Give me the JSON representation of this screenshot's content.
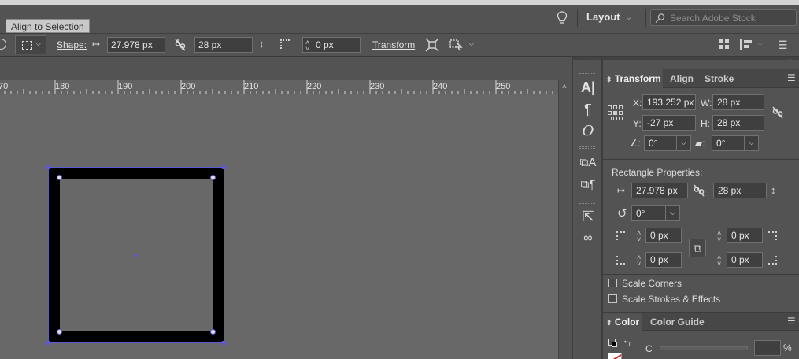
{
  "tooltip": "Align to Selection",
  "workspace": {
    "label": "Layout"
  },
  "stock_search": {
    "placeholder": "Search Adobe Stock"
  },
  "control_bar": {
    "shape_label": "Shape:",
    "width_value": "27.978 px",
    "height_value": "28 px",
    "corner_value": "0 px",
    "transform_label": "Transform"
  },
  "ruler": {
    "ticks": [
      "70",
      "180",
      "190",
      "200",
      "210",
      "220",
      "230",
      "240",
      "250"
    ]
  },
  "panel": {
    "tabs": [
      "Transform",
      "Align",
      "Stroke"
    ],
    "transform": {
      "x_label": "X:",
      "x_value": "193.252 px",
      "y_label": "Y:",
      "y_value": "-27 px",
      "w_label": "W:",
      "w_value": "28 px",
      "h_label": "H:",
      "h_value": "28 px",
      "angle_value": "0°",
      "shear_value": "0°"
    },
    "rect_props": {
      "title": "Rectangle Properties:",
      "width_value": "27.978 px",
      "height_value": "28 px",
      "rotation_value": "0°",
      "corner_tl": "0 px",
      "corner_tr": "0 px",
      "corner_bl": "0 px",
      "corner_br": "0 px"
    },
    "options": {
      "scale_corners": "Scale Corners",
      "scale_strokes": "Scale Strokes & Effects"
    },
    "color_tabs": [
      "Color",
      "Color Guide"
    ],
    "color": {
      "c_label": "C",
      "percent": "%"
    }
  },
  "colors": {
    "selection": "#5b5bd6",
    "shape_fill": "#000000",
    "canvas": "#686868"
  }
}
